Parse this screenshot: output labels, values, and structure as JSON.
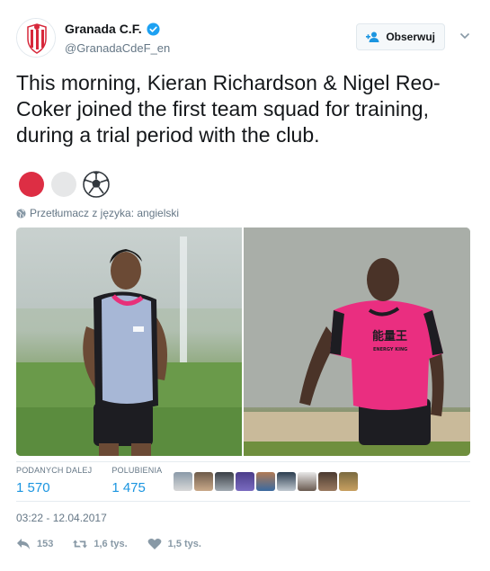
{
  "account": {
    "display_name": "Granada C.F.",
    "handle": "@GranadaCdeF_en",
    "verified": true,
    "brand_color": "#d7283b"
  },
  "follow_button": {
    "label": "Obserwuj",
    "icon": "add-user-icon"
  },
  "tweet": {
    "text": "This morning, Kieran Richardson & Nigel Reo-Coker joined the first team squad for training, during a trial period with the club.",
    "emojis": [
      "red-circle",
      "white-circle",
      "soccer-ball"
    ],
    "translate_label": "Przetłumacz z języka: angielski"
  },
  "media": {
    "photos": [
      {
        "name": "player-in-blue-bib",
        "jersey_text": "Joma"
      },
      {
        "name": "player-in-pink-shirt",
        "jersey_text": "能量王",
        "jersey_subtext": "ENERGY KING"
      }
    ]
  },
  "stats": {
    "retweets_label": "PODANYCH DALEJ",
    "retweets_value": "1 570",
    "likes_label": "POLUBIENIA",
    "likes_value": "1 475",
    "liker_count": 9
  },
  "timestamp": "03:22 - 12.04.2017",
  "actions": {
    "reply_count": "153",
    "retweet_count": "1,6 tys.",
    "like_count": "1,5 tys."
  },
  "colors": {
    "link": "#1b95e0",
    "muted": "#657786",
    "accent_pink": "#e8307a"
  }
}
